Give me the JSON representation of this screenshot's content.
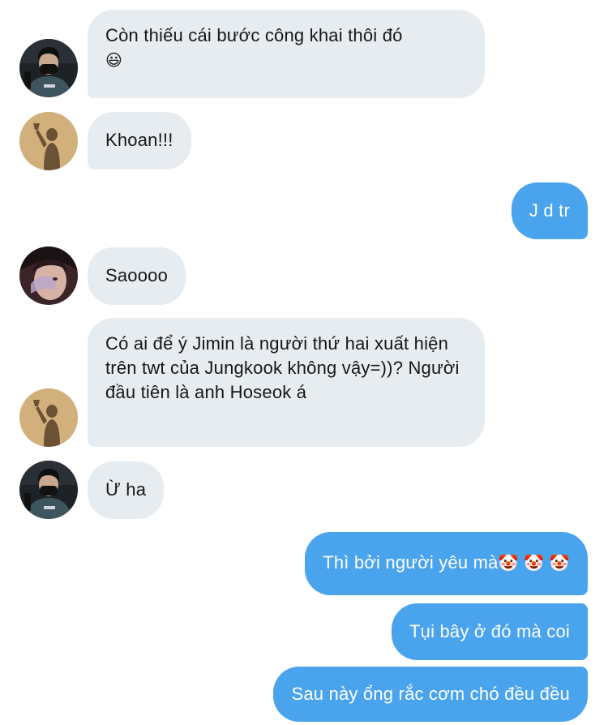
{
  "conversation": {
    "messages": [
      {
        "direction": "incoming",
        "text": "Còn thiếu cái bước công khai thôi đó",
        "emoji": "😃",
        "avatar": "user-a"
      },
      {
        "direction": "incoming",
        "text": "Khoan!!!",
        "avatar": "user-b"
      },
      {
        "direction": "outgoing",
        "text": "J d tr"
      },
      {
        "direction": "incoming",
        "text": "Saoooo",
        "avatar": "user-c"
      },
      {
        "direction": "incoming",
        "text": "Có ai để ý Jimin là người thứ hai xuất hiện trên twt của Jungkook không vậy=))? Người đầu tiên là anh Hoseok á",
        "avatar": "user-b"
      },
      {
        "direction": "incoming",
        "text": "Ừ ha",
        "avatar": "user-a"
      },
      {
        "direction": "outgoing",
        "text": "Thì bởi người yêu mà",
        "emoji": "🤡 🤡 🤡"
      },
      {
        "direction": "outgoing",
        "text": "Tụi bây ở đó mà coi"
      },
      {
        "direction": "outgoing",
        "text": "Sau này ổng rắc cơm chó đều đều"
      }
    ]
  },
  "colors": {
    "incoming_bubble": "#e6ecf0",
    "outgoing_bubble": "#4aa3ed",
    "text_dark": "#14171a",
    "text_light": "#ffffff"
  }
}
